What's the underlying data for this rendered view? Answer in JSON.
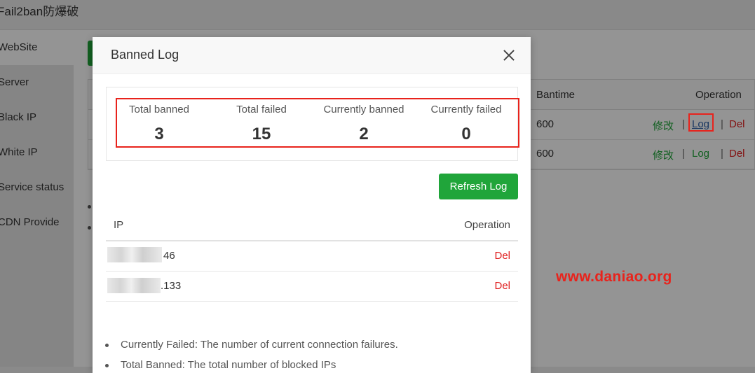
{
  "app": {
    "title": "Fail2ban防爆破",
    "sidebar": [
      "WebSite",
      "Server",
      "Black IP",
      "White IP",
      "Service status",
      "CDN Provide"
    ],
    "table": {
      "columns": [
        "Bantime",
        "Operation"
      ],
      "rows": [
        {
          "bantime": "600",
          "edit": "修改",
          "log": "Log",
          "del": "Del"
        },
        {
          "bantime": "600",
          "edit": "修改",
          "log": "Log",
          "del": "Del"
        }
      ],
      "separator": "|"
    }
  },
  "watermark": "www.daniao.org",
  "modal": {
    "title": "Banned Log",
    "stats": [
      {
        "label": "Total banned",
        "value": "3"
      },
      {
        "label": "Total failed",
        "value": "15"
      },
      {
        "label": "Currently banned",
        "value": "2"
      },
      {
        "label": "Currently failed",
        "value": "0"
      }
    ],
    "refresh_label": "Refresh Log",
    "log_table": {
      "col_ip": "IP",
      "col_operation": "Operation",
      "rows": [
        {
          "ip_suffix": "46",
          "action": "Del"
        },
        {
          "ip_suffix": ".133",
          "action": "Del"
        }
      ]
    },
    "notes": [
      "Currently Failed: The number of current connection failures.",
      "Total Banned: The total number of blocked IPs"
    ]
  },
  "colors": {
    "accent_green": "#20a53a",
    "danger_red": "#e02020",
    "annotation_red": "#e8231c"
  },
  "icons": {
    "close": "close-icon"
  }
}
